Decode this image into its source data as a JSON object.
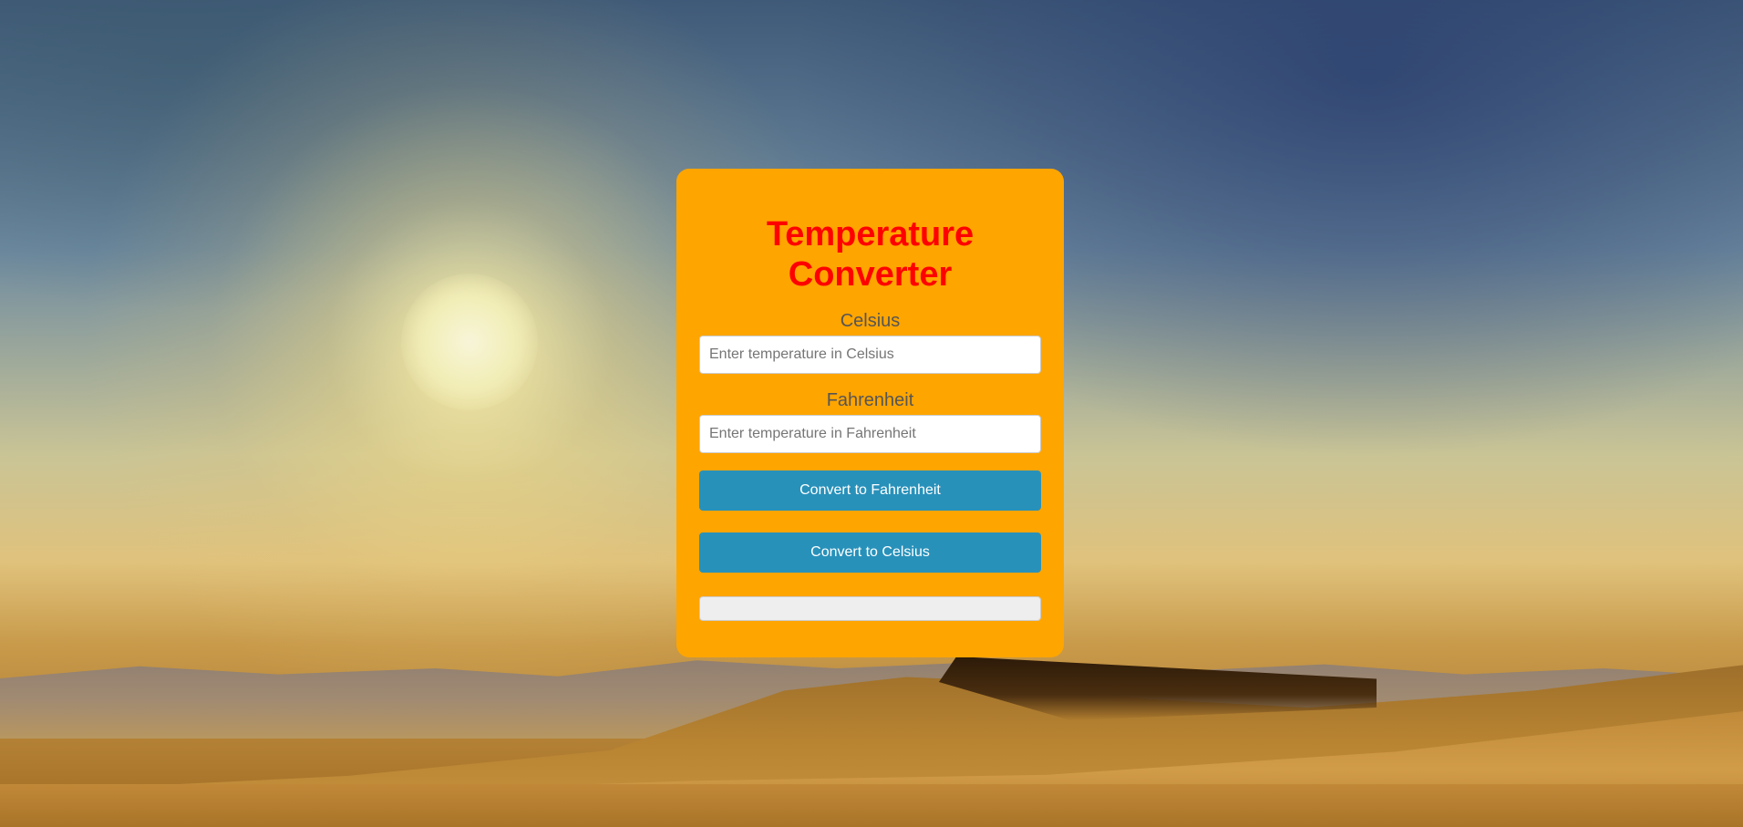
{
  "converter": {
    "title": "Temperature Converter",
    "celsius": {
      "label": "Celsius",
      "value": "",
      "placeholder": "Enter temperature in Celsius"
    },
    "fahrenheit": {
      "label": "Fahrenheit",
      "value": "",
      "placeholder": "Enter temperature in Fahrenheit"
    },
    "buttons": {
      "to_fahrenheit": "Convert to Fahrenheit",
      "to_celsius": "Convert to Celsius"
    },
    "result": ""
  },
  "colors": {
    "card_background": "#ffa500",
    "title_color": "#ff0000",
    "button_background": "#2891ba",
    "button_text": "#ffffff",
    "label_color": "#555555",
    "result_background": "#eeeeee"
  },
  "background": {
    "scene": "desert-sunset-with-sun-and-dunes"
  }
}
